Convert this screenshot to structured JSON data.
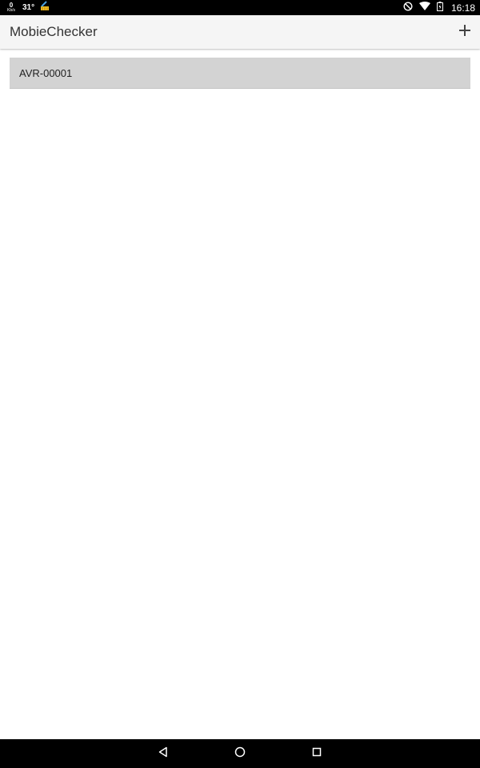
{
  "status_bar": {
    "net_speed_value": "0",
    "net_speed_unit": "Kb/s",
    "temperature": "31°",
    "time": "16:18",
    "icons": [
      "cleaner-icon",
      "do-not-disturb-icon",
      "wifi-icon",
      "battery-icon"
    ]
  },
  "app_bar": {
    "title": "MobieChecker",
    "action_icon": "plus-icon"
  },
  "list": {
    "items": [
      {
        "label": "AVR-00001"
      }
    ]
  },
  "nav_bar": {
    "icons": [
      "back-icon",
      "home-icon",
      "recents-icon"
    ]
  },
  "colors": {
    "status_bar": "#000000",
    "app_bar": "#f5f5f5",
    "list_item": "#d3d3d3",
    "nav_bar": "#000000"
  }
}
